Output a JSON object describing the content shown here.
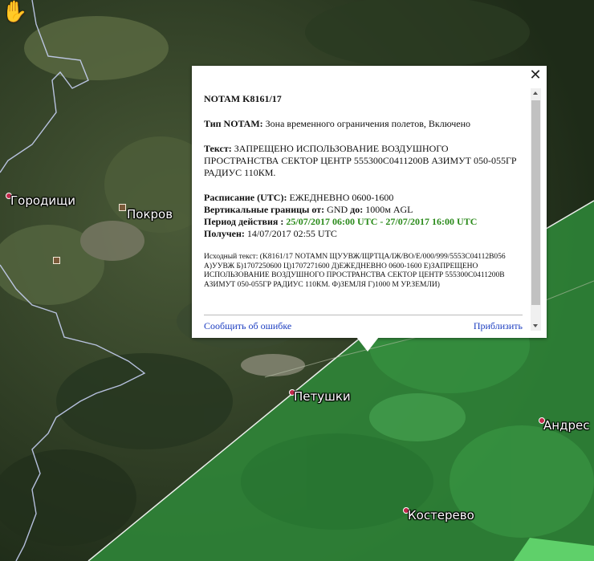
{
  "popup": {
    "title": "NOTAM K8161/17",
    "type_label": "Тип NOTAM:",
    "type_value": "Зона временного ограничения полетов, Включено",
    "text_label": "Текст:",
    "text_value": "ЗАПРЕЩЕНО ИСПОЛЬЗОВАНИЕ ВОЗДУШНОГО ПРОСТРАНСТВА СЕКТОР ЦЕНТР 555300С0411200В АЗИМУТ 050-055ГР РАДИУС 110КМ.",
    "schedule_label": "Расписание (UTC):",
    "schedule_value": "ЕЖЕДНЕВНО 0600-1600",
    "vertical_label": "Вертикальные границы от:",
    "vertical_from": "GND",
    "vertical_to_label": "до:",
    "vertical_to": "1000м AGL",
    "period_label": "Период действия :",
    "period_value": "25/07/2017 06:00 UTC - 27/07/2017 16:00 UTC",
    "received_label": "Получен:",
    "received_value": "14/07/2017 02:55 UTC",
    "raw_text": "Исходный текст: (K8161/17 NOTAMN ЩУУВЖ/ЩРТЦА/IЖ/BO/E/000/999/5553С04112В056 А)УУВЖ Б)1707250600 Ц)1707271600 Д)ЕЖЕДНЕВНО 0600-1600 Е)ЗАПРЕЩЕНО ИСПОЛЬЗОВАНИЕ ВОЗДУШНОГО ПРОСТРАНСТВА СЕКТОР ЦЕНТР 555300С0411200В АЗИМУТ 050-055ГР РАДИУС 110КМ. Ф)ЗЕМЛЯ Г)1000 М УР.ЗЕМЛИ)",
    "report_link": "Сообщить об ошибке",
    "zoom_link": "Приблизить",
    "close_symbol": "✕"
  },
  "map": {
    "towns": [
      {
        "name": "Городищи"
      },
      {
        "name": "Покров"
      },
      {
        "name": "Петушки"
      },
      {
        "name": "Андрес"
      },
      {
        "name": "Костерево"
      }
    ],
    "colors": {
      "zone_fill": "#2f8a3a",
      "boundary": "#cfd8ff"
    }
  }
}
